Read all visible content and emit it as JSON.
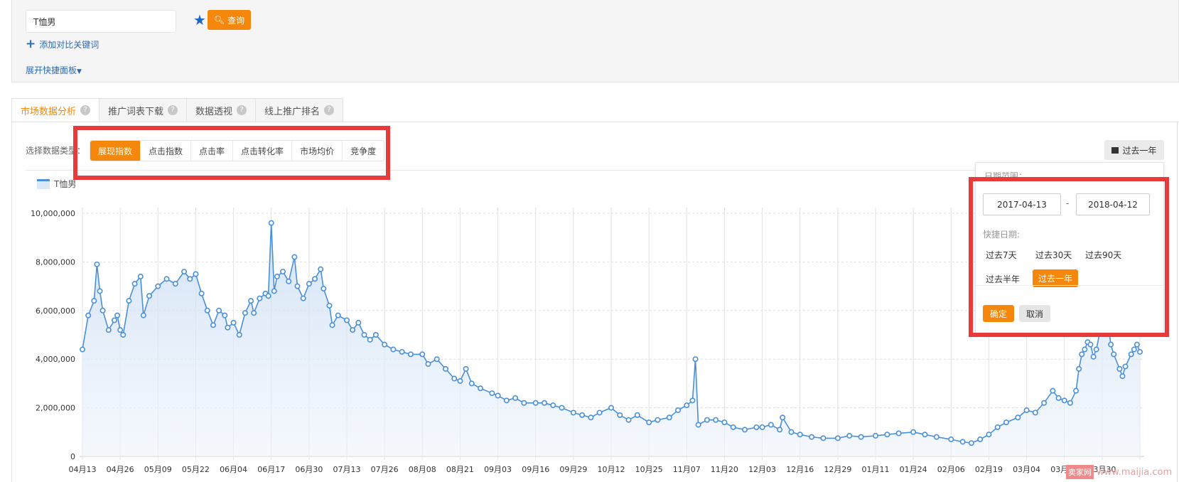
{
  "search": {
    "keyword": "T恤男",
    "query_label": "查询",
    "add_compare": "添加对比关键词",
    "expand_panel": "展开快捷面板"
  },
  "tabs": [
    {
      "label": "市场数据分析",
      "active": true
    },
    {
      "label": "推广词表下载"
    },
    {
      "label": "数据透视"
    },
    {
      "label": "线上推广排名"
    }
  ],
  "data_type": {
    "label": "选择数据类型",
    "colon": "：",
    "options": [
      "展现指数",
      "点击指数",
      "点击率",
      "点击转化率",
      "市场均价",
      "竞争度"
    ],
    "selected": "展现指数"
  },
  "date_button": {
    "label": "过去一年",
    "icon": "calendar-icon"
  },
  "date_popup": {
    "range_label": "日期范围：",
    "start": "2017-04-13",
    "end": "2018-04-12",
    "dash": "-",
    "quick_label": "快捷日期:",
    "quick_options": [
      "过去7天",
      "过去30天",
      "过去90天",
      "过去半年",
      "过去一年"
    ],
    "selected": "过去一年",
    "confirm": "确定",
    "cancel": "取消"
  },
  "colors": {
    "accent": "#f5870d",
    "line": "#4a90d9",
    "highlight": "#e83a3a"
  },
  "watermark": {
    "logo": "卖家网",
    "text": "www.maijia.com"
  },
  "chart_data": {
    "type": "area",
    "legend": [
      "T恤男"
    ],
    "legend_position": "top-left",
    "ylim": [
      0,
      10000000
    ],
    "yticks": [
      "0",
      "2,000,000",
      "4,000,000",
      "6,000,000",
      "8,000,000",
      "10,000,000"
    ],
    "xticks": [
      "04月13",
      "04月26",
      "05月09",
      "05月22",
      "06月04",
      "06月17",
      "06月30",
      "07月13",
      "07月26",
      "08月08",
      "08月21",
      "09月03",
      "09月16",
      "09月29",
      "10月12",
      "10月25",
      "11月07",
      "11月20",
      "12月03",
      "12月16",
      "12月29",
      "01月11",
      "01月24",
      "02月06",
      "02月19",
      "03月04",
      "03月17",
      "03月30"
    ],
    "grid": true,
    "series": [
      {
        "name": "T恤男",
        "points": [
          [
            "2017-04-13",
            4400000
          ],
          [
            "2017-04-15",
            5800000
          ],
          [
            "2017-04-17",
            6400000
          ],
          [
            "2017-04-18",
            7900000
          ],
          [
            "2017-04-19",
            6800000
          ],
          [
            "2017-04-20",
            6000000
          ],
          [
            "2017-04-22",
            5200000
          ],
          [
            "2017-04-24",
            5600000
          ],
          [
            "2017-04-25",
            5800000
          ],
          [
            "2017-04-26",
            5200000
          ],
          [
            "2017-04-27",
            5000000
          ],
          [
            "2017-04-29",
            6400000
          ],
          [
            "2017-05-01",
            7100000
          ],
          [
            "2017-05-03",
            7400000
          ],
          [
            "2017-05-04",
            5800000
          ],
          [
            "2017-05-06",
            6600000
          ],
          [
            "2017-05-09",
            7000000
          ],
          [
            "2017-05-12",
            7300000
          ],
          [
            "2017-05-15",
            7100000
          ],
          [
            "2017-05-18",
            7600000
          ],
          [
            "2017-05-20",
            7300000
          ],
          [
            "2017-05-22",
            7500000
          ],
          [
            "2017-05-24",
            6700000
          ],
          [
            "2017-05-26",
            6000000
          ],
          [
            "2017-05-28",
            5400000
          ],
          [
            "2017-05-30",
            6000000
          ],
          [
            "2017-06-01",
            5800000
          ],
          [
            "2017-06-02",
            5300000
          ],
          [
            "2017-06-04",
            5500000
          ],
          [
            "2017-06-06",
            5000000
          ],
          [
            "2017-06-08",
            5900000
          ],
          [
            "2017-06-10",
            6400000
          ],
          [
            "2017-06-11",
            5900000
          ],
          [
            "2017-06-13",
            6500000
          ],
          [
            "2017-06-15",
            6700000
          ],
          [
            "2017-06-16",
            6600000
          ],
          [
            "2017-06-17",
            9600000
          ],
          [
            "2017-06-18",
            6800000
          ],
          [
            "2017-06-19",
            7400000
          ],
          [
            "2017-06-21",
            7600000
          ],
          [
            "2017-06-23",
            7200000
          ],
          [
            "2017-06-25",
            8200000
          ],
          [
            "2017-06-26",
            7000000
          ],
          [
            "2017-06-28",
            6500000
          ],
          [
            "2017-06-30",
            7100000
          ],
          [
            "2017-07-02",
            7300000
          ],
          [
            "2017-07-04",
            7700000
          ],
          [
            "2017-07-05",
            6900000
          ],
          [
            "2017-07-07",
            6200000
          ],
          [
            "2017-07-08",
            5400000
          ],
          [
            "2017-07-10",
            5800000
          ],
          [
            "2017-07-13",
            5600000
          ],
          [
            "2017-07-15",
            5200000
          ],
          [
            "2017-07-17",
            5500000
          ],
          [
            "2017-07-19",
            5000000
          ],
          [
            "2017-07-21",
            4800000
          ],
          [
            "2017-07-23",
            5000000
          ],
          [
            "2017-07-26",
            4600000
          ],
          [
            "2017-07-29",
            4400000
          ],
          [
            "2017-08-01",
            4300000
          ],
          [
            "2017-08-04",
            4200000
          ],
          [
            "2017-08-08",
            4200000
          ],
          [
            "2017-08-10",
            3800000
          ],
          [
            "2017-08-13",
            4000000
          ],
          [
            "2017-08-16",
            3600000
          ],
          [
            "2017-08-19",
            3200000
          ],
          [
            "2017-08-21",
            3100000
          ],
          [
            "2017-08-23",
            3600000
          ],
          [
            "2017-08-25",
            3000000
          ],
          [
            "2017-08-28",
            2800000
          ],
          [
            "2017-09-01",
            2600000
          ],
          [
            "2017-09-03",
            2500000
          ],
          [
            "2017-09-06",
            2300000
          ],
          [
            "2017-09-09",
            2400000
          ],
          [
            "2017-09-12",
            2200000
          ],
          [
            "2017-09-16",
            2200000
          ],
          [
            "2017-09-19",
            2200000
          ],
          [
            "2017-09-22",
            2100000
          ],
          [
            "2017-09-25",
            2000000
          ],
          [
            "2017-09-29",
            1800000
          ],
          [
            "2017-10-02",
            1700000
          ],
          [
            "2017-10-05",
            1600000
          ],
          [
            "2017-10-08",
            1800000
          ],
          [
            "2017-10-12",
            2000000
          ],
          [
            "2017-10-15",
            1700000
          ],
          [
            "2017-10-18",
            1500000
          ],
          [
            "2017-10-21",
            1700000
          ],
          [
            "2017-10-25",
            1400000
          ],
          [
            "2017-10-28",
            1500000
          ],
          [
            "2017-11-01",
            1600000
          ],
          [
            "2017-11-04",
            1900000
          ],
          [
            "2017-11-07",
            2100000
          ],
          [
            "2017-11-09",
            2300000
          ],
          [
            "2017-11-10",
            4000000
          ],
          [
            "2017-11-11",
            1300000
          ],
          [
            "2017-11-14",
            1500000
          ],
          [
            "2017-11-17",
            1500000
          ],
          [
            "2017-11-20",
            1400000
          ],
          [
            "2017-11-23",
            1200000
          ],
          [
            "2017-11-27",
            1100000
          ],
          [
            "2017-12-01",
            1200000
          ],
          [
            "2017-12-03",
            1200000
          ],
          [
            "2017-12-06",
            1300000
          ],
          [
            "2017-12-09",
            1100000
          ],
          [
            "2017-12-10",
            1600000
          ],
          [
            "2017-12-13",
            1000000
          ],
          [
            "2017-12-16",
            900000
          ],
          [
            "2017-12-20",
            800000
          ],
          [
            "2017-12-24",
            750000
          ],
          [
            "2017-12-29",
            750000
          ],
          [
            "2018-01-02",
            850000
          ],
          [
            "2018-01-06",
            800000
          ],
          [
            "2018-01-11",
            850000
          ],
          [
            "2018-01-15",
            900000
          ],
          [
            "2018-01-19",
            950000
          ],
          [
            "2018-01-24",
            1000000
          ],
          [
            "2018-01-28",
            900000
          ],
          [
            "2018-02-01",
            800000
          ],
          [
            "2018-02-06",
            700000
          ],
          [
            "2018-02-10",
            600000
          ],
          [
            "2018-02-13",
            550000
          ],
          [
            "2018-02-16",
            700000
          ],
          [
            "2018-02-19",
            900000
          ],
          [
            "2018-02-22",
            1200000
          ],
          [
            "2018-02-25",
            1400000
          ],
          [
            "2018-03-01",
            1600000
          ],
          [
            "2018-03-04",
            1900000
          ],
          [
            "2018-03-07",
            1800000
          ],
          [
            "2018-03-10",
            2200000
          ],
          [
            "2018-03-13",
            2700000
          ],
          [
            "2018-03-15",
            2400000
          ],
          [
            "2018-03-17",
            2300000
          ],
          [
            "2018-03-19",
            2200000
          ],
          [
            "2018-03-21",
            2700000
          ],
          [
            "2018-03-22",
            3600000
          ],
          [
            "2018-03-23",
            4200000
          ],
          [
            "2018-03-24",
            4400000
          ],
          [
            "2018-03-25",
            4700000
          ],
          [
            "2018-03-26",
            4600000
          ],
          [
            "2018-03-27",
            4100000
          ],
          [
            "2018-03-28",
            4400000
          ],
          [
            "2018-03-30",
            5600000
          ],
          [
            "2018-04-01",
            5500000
          ],
          [
            "2018-04-02",
            4600000
          ],
          [
            "2018-04-03",
            4200000
          ],
          [
            "2018-04-05",
            3600000
          ],
          [
            "2018-04-06",
            3300000
          ],
          [
            "2018-04-07",
            3700000
          ],
          [
            "2018-04-09",
            4200000
          ],
          [
            "2018-04-10",
            4400000
          ],
          [
            "2018-04-11",
            4600000
          ],
          [
            "2018-04-12",
            4300000
          ]
        ]
      }
    ]
  }
}
